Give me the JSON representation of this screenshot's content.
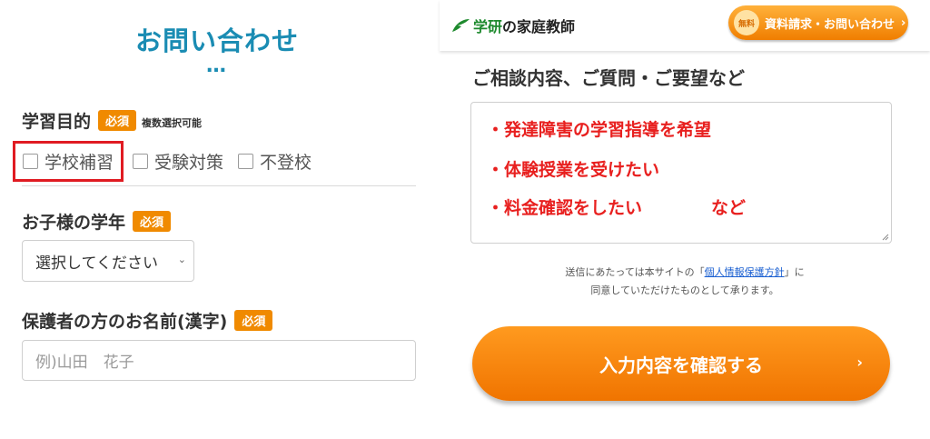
{
  "left": {
    "title": "お問い合わせ",
    "dots": "…",
    "purpose": {
      "label": "学習目的",
      "required": "必須",
      "note": "複数選択可能",
      "options": [
        "学校補習",
        "受験対策",
        "不登校"
      ]
    },
    "grade": {
      "label": "お子様の学年",
      "required": "必須",
      "select_value": "選択してください"
    },
    "guardian": {
      "label": "保護者の方のお名前(漢字)",
      "required": "必須",
      "placeholder": "例)山田　花子"
    }
  },
  "right": {
    "brand_part1": "学研",
    "brand_part2": "の家庭教師",
    "header_button": {
      "free": "無料",
      "label": "資料請求・お問い合わせ",
      "chevron": "›"
    },
    "consult_label": "ご相談内容、ご質問・ご要望など",
    "textarea_lines": [
      "・発達障害の学習指導を希望",
      "・体験授業を受けたい",
      "・料金確認をしたい　　　　など"
    ],
    "privacy": {
      "pre": "送信にあたっては本サイトの「",
      "link": "個人情報保護方針",
      "post": "」に",
      "line2": "同意していただけたものとして承ります。"
    },
    "cta": {
      "label": "入力内容を確認する",
      "chevron": "›"
    }
  },
  "colors": {
    "accent": "#1a8cb3",
    "orange": "#f08a00",
    "red": "#e8201f",
    "green": "#1e8a2e"
  }
}
